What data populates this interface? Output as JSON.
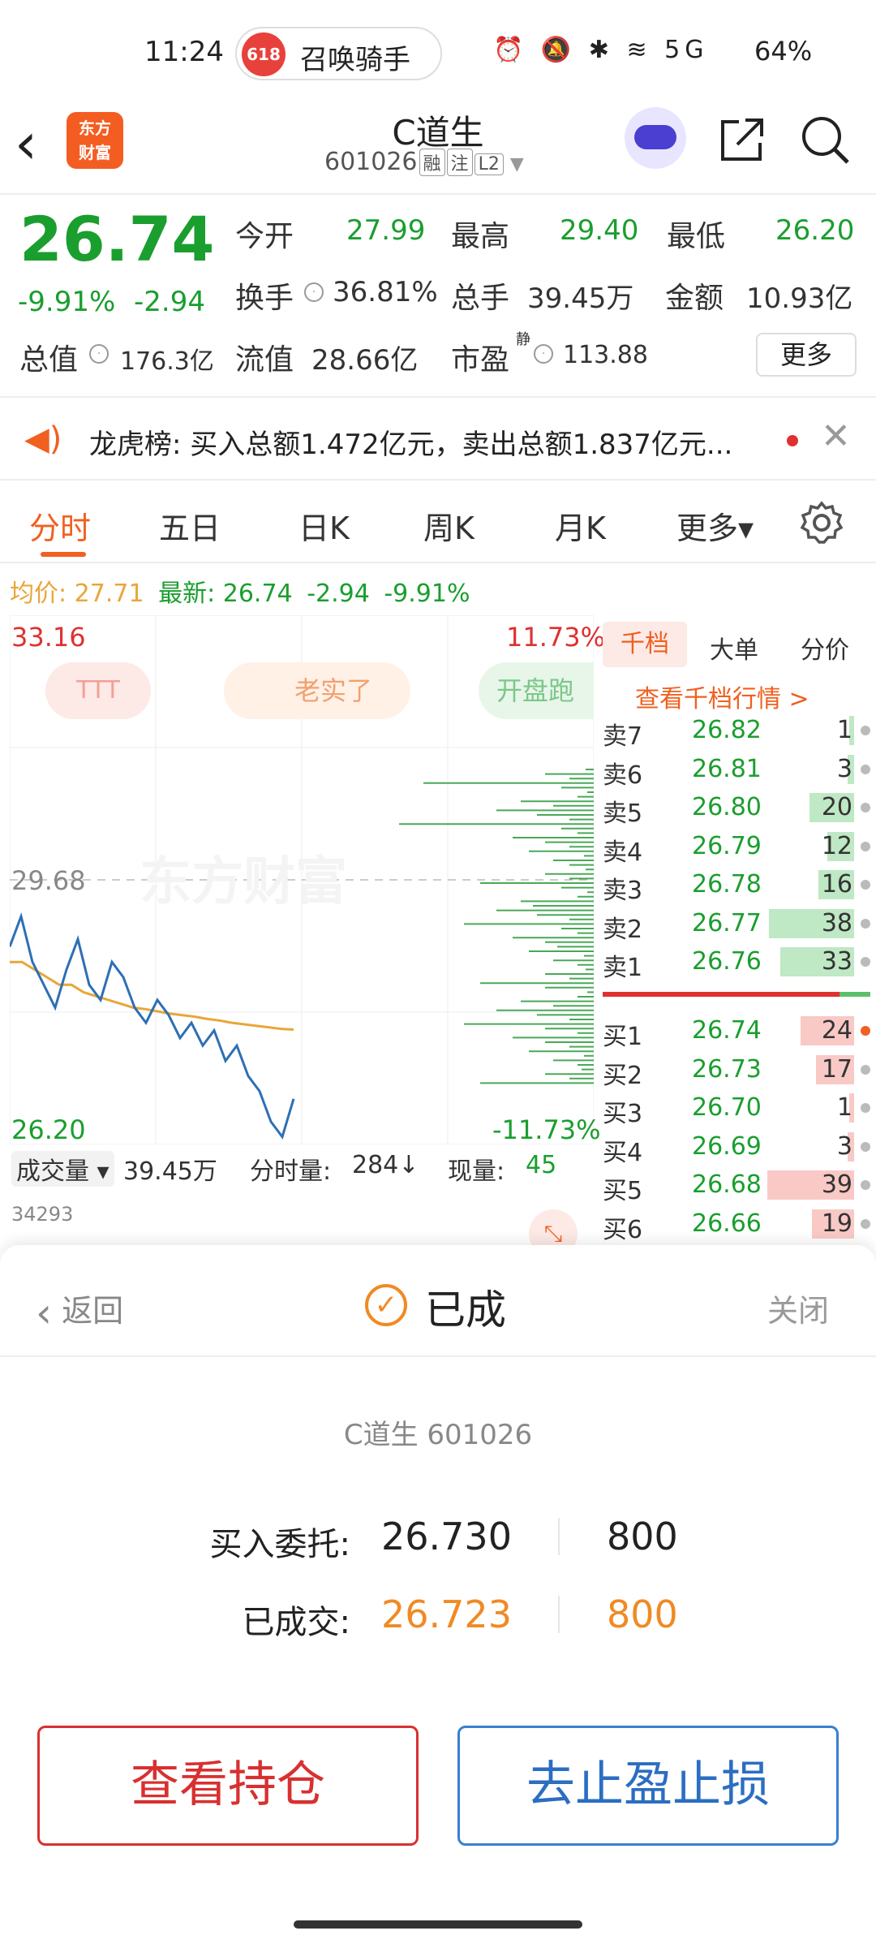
{
  "status_bar": {
    "time": "11:24",
    "notification": "召唤骑手",
    "notification_badge": "618",
    "battery": "64%",
    "icons": "⏰ 🔕 ✱ ≋ 5G"
  },
  "header": {
    "logo": "东方\n财富",
    "stock_name": "C道生",
    "stock_code": "601026",
    "tags": [
      "融",
      "注",
      "L2"
    ]
  },
  "quote": {
    "price": "26.74",
    "change_pct": "-9.91%",
    "change_abs": "-2.94",
    "open_label": "今开",
    "open": "27.99",
    "high_label": "最高",
    "high": "29.40",
    "low_label": "最低",
    "low": "26.20",
    "turnover_label": "换手",
    "turnover": "36.81%",
    "volume_label": "总手",
    "volume": "39.45万",
    "amount_label": "金额",
    "amount": "10.93亿",
    "mktcap_label": "总值",
    "mktcap": "176.3亿",
    "float_label": "流值",
    "float": "28.66亿",
    "pe_label": "市盈",
    "pe_sup": "静",
    "pe": "113.88",
    "more": "更多"
  },
  "news": {
    "text": "龙虎榜: 买入总额1.472亿元，卖出总额1.837亿元..."
  },
  "tabs": [
    {
      "label": "分时"
    },
    {
      "label": "五日"
    },
    {
      "label": "日K"
    },
    {
      "label": "周K"
    },
    {
      "label": "月K"
    },
    {
      "label": "更多▾"
    }
  ],
  "avg_line": {
    "avg_label": "均价:",
    "avg": "27.71",
    "latest_label": "最新:",
    "latest": "26.74",
    "chg": "-2.94",
    "pct": "-9.91%"
  },
  "chart": {
    "top_price": "33.16",
    "mid_price": "29.68",
    "bottom_price": "26.20",
    "top_pct": "11.73%",
    "bottom_pct": "-11.73%",
    "watermark": "东方财富",
    "chips": [
      "TTT",
      "老实了",
      "开盘跑"
    ]
  },
  "chart_data": {
    "type": "line",
    "series": [
      {
        "name": "最新",
        "values": [
          28.8,
          29.2,
          28.6,
          28.3,
          28.0,
          28.5,
          28.9,
          28.3,
          28.1,
          28.6,
          28.4,
          28.0,
          27.8,
          28.1,
          27.9,
          27.6,
          27.8,
          27.5,
          27.7,
          27.3,
          27.5,
          27.1,
          26.9,
          26.5,
          26.3,
          26.8
        ]
      },
      {
        "name": "均价",
        "values": [
          28.6,
          28.6,
          28.5,
          28.4,
          28.3,
          28.3,
          28.2,
          28.15,
          28.1,
          28.05,
          28.0,
          27.98,
          27.95,
          27.92,
          27.9,
          27.88,
          27.85,
          27.83,
          27.8,
          27.78,
          27.76,
          27.74,
          27.72,
          27.71
        ]
      }
    ],
    "ylim": [
      26.2,
      33.16
    ]
  },
  "orderbook": {
    "tabs": [
      "千档",
      "大单",
      "分价"
    ],
    "link": "查看千档行情 >",
    "asks": [
      {
        "label": "卖7",
        "price": "26.82",
        "vol": "1"
      },
      {
        "label": "卖6",
        "price": "26.81",
        "vol": "3"
      },
      {
        "label": "卖5",
        "price": "26.80",
        "vol": "20"
      },
      {
        "label": "卖4",
        "price": "26.79",
        "vol": "12"
      },
      {
        "label": "卖3",
        "price": "26.78",
        "vol": "16"
      },
      {
        "label": "卖2",
        "price": "26.77",
        "vol": "38"
      },
      {
        "label": "卖1",
        "price": "26.76",
        "vol": "33"
      }
    ],
    "bids": [
      {
        "label": "买1",
        "price": "26.74",
        "vol": "24"
      },
      {
        "label": "买2",
        "price": "26.73",
        "vol": "17"
      },
      {
        "label": "买3",
        "price": "26.70",
        "vol": "1"
      },
      {
        "label": "买4",
        "price": "26.69",
        "vol": "3"
      },
      {
        "label": "买5",
        "price": "26.68",
        "vol": "39"
      },
      {
        "label": "买6",
        "price": "26.66",
        "vol": "19"
      }
    ]
  },
  "volume_bar": {
    "select": "成交量 ▾",
    "total": "39.45万",
    "tick_label": "分时量:",
    "tick": "284↓",
    "now_label": "现量:",
    "now": "45",
    "max": "34293"
  },
  "dialog": {
    "back": "返回",
    "title": "已成",
    "close": "关闭",
    "stock": "C道生 601026",
    "order_label": "买入委托:",
    "order_price": "26.730",
    "order_qty": "800",
    "fill_label": "已成交:",
    "fill_price": "26.723",
    "fill_qty": "800",
    "btn_hold": "查看持仓",
    "btn_stop": "去止盈止损"
  },
  "colors": {
    "up": "#e03030",
    "down": "#1a9e2e",
    "accent": "#f06020",
    "avg": "#e8a63a",
    "price_line": "#2e6fb5"
  }
}
